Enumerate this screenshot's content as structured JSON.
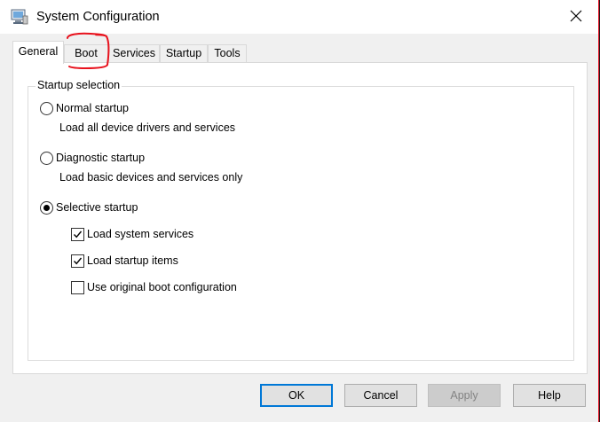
{
  "window": {
    "title": "System Configuration",
    "close_icon": "close-x-icon",
    "app_icon": "system-configuration-icon"
  },
  "tabs": [
    {
      "label": "General",
      "active": true
    },
    {
      "label": "Boot",
      "active": false
    },
    {
      "label": "Services",
      "active": false
    },
    {
      "label": "Startup",
      "active": false
    },
    {
      "label": "Tools",
      "active": false
    }
  ],
  "startup_selection": {
    "legend": "Startup selection",
    "normal": {
      "label": "Normal startup",
      "description": "Load all device drivers and services",
      "selected": false
    },
    "diagnostic": {
      "label": "Diagnostic startup",
      "description": "Load basic devices and services only",
      "selected": false
    },
    "selective": {
      "label": "Selective startup",
      "selected": true
    },
    "options": [
      {
        "label": "Load system services",
        "checked": true
      },
      {
        "label": "Load startup items",
        "checked": true
      },
      {
        "label": "Use original boot configuration",
        "checked": false
      }
    ]
  },
  "buttons": {
    "ok": "OK",
    "cancel": "Cancel",
    "apply": "Apply",
    "help": "Help"
  },
  "colors": {
    "annotation": "#e8121d",
    "accent": "#0078d7",
    "window_border": "#e81123"
  }
}
